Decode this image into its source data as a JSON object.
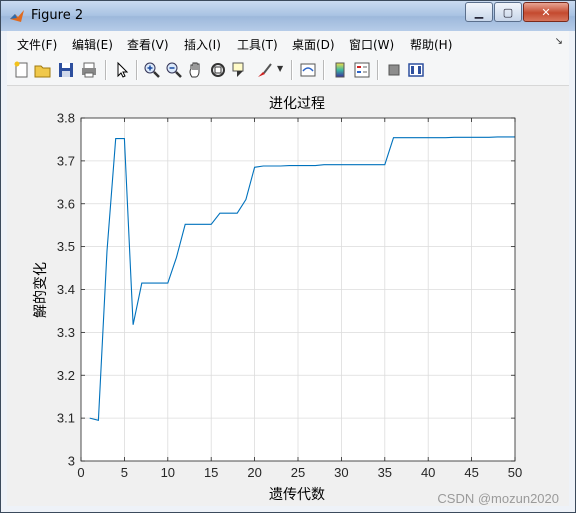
{
  "window": {
    "title": "Figure 2"
  },
  "menu": [
    "文件(F)",
    "编辑(E)",
    "查看(V)",
    "插入(I)",
    "工具(T)",
    "桌面(D)",
    "窗口(W)",
    "帮助(H)"
  ],
  "toolbar_icons": [
    "new-figure-icon",
    "open-file-icon",
    "save-icon",
    "print-icon",
    "pointer-icon",
    "zoom-in-icon",
    "zoom-out-icon",
    "pan-icon",
    "rotate-3d-icon",
    "data-cursor-icon",
    "brush-icon",
    "link-plot-icon",
    "colorbar-icon",
    "legend-icon",
    "hide-plot-tools-icon",
    "show-plot-tools-icon"
  ],
  "watermark": "CSDN @mozun2020",
  "chart_data": {
    "type": "line",
    "title": "进化过程",
    "xlabel": "遗传代数",
    "ylabel": "解的变化",
    "xlim": [
      0,
      50
    ],
    "ylim": [
      3,
      3.8
    ],
    "xticks": [
      0,
      5,
      10,
      15,
      20,
      25,
      30,
      35,
      40,
      45,
      50
    ],
    "yticks": [
      3,
      3.1,
      3.2,
      3.3,
      3.4,
      3.5,
      3.6,
      3.7,
      3.8
    ],
    "grid": true,
    "color": "#0072BD",
    "x": [
      1,
      2,
      3,
      4,
      5,
      6,
      7,
      8,
      9,
      10,
      11,
      12,
      13,
      14,
      15,
      16,
      17,
      18,
      19,
      20,
      21,
      22,
      23,
      24,
      25,
      26,
      27,
      28,
      29,
      30,
      31,
      32,
      33,
      34,
      35,
      36,
      37,
      38,
      39,
      40,
      41,
      42,
      43,
      44,
      45,
      46,
      47,
      48,
      49,
      50
    ],
    "y": [
      3.1,
      3.095,
      3.49,
      3.752,
      3.752,
      3.318,
      3.415,
      3.415,
      3.415,
      3.415,
      3.475,
      3.552,
      3.552,
      3.552,
      3.552,
      3.578,
      3.578,
      3.578,
      3.61,
      3.685,
      3.688,
      3.688,
      3.688,
      3.689,
      3.689,
      3.689,
      3.689,
      3.691,
      3.691,
      3.691,
      3.691,
      3.691,
      3.691,
      3.691,
      3.691,
      3.754,
      3.754,
      3.754,
      3.754,
      3.754,
      3.754,
      3.754,
      3.755,
      3.755,
      3.755,
      3.755,
      3.755,
      3.756,
      3.756,
      3.756
    ]
  }
}
